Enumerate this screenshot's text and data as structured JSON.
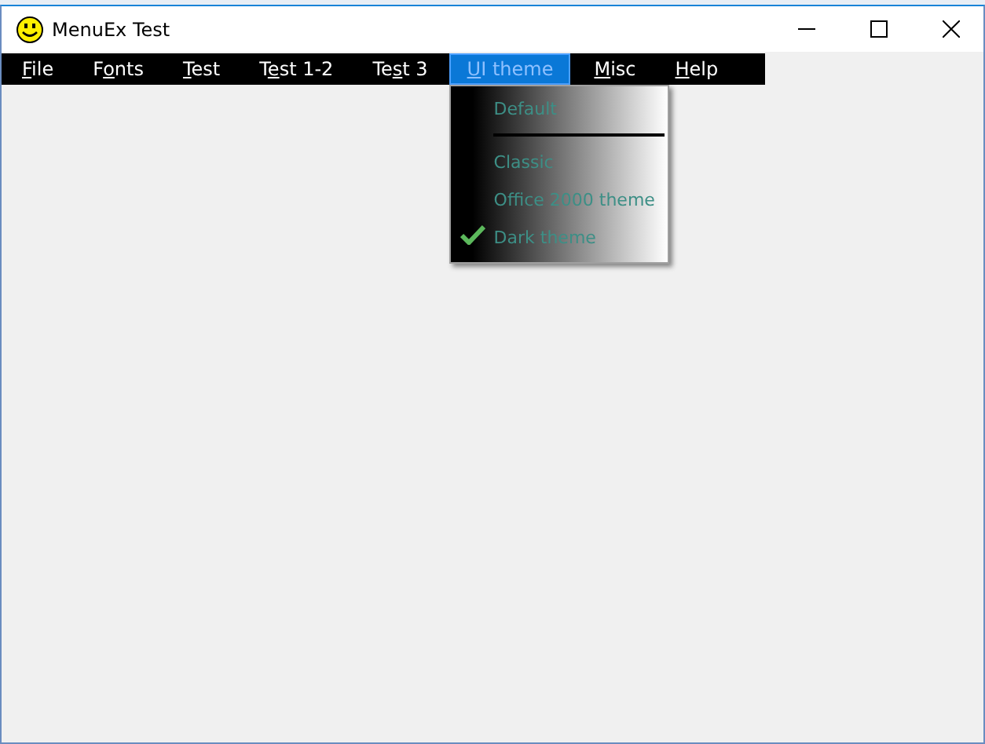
{
  "window": {
    "title": "MenuEx Test"
  },
  "menu_bar": [
    {
      "label": [
        {
          "text": "F",
          "underlined": true
        },
        {
          "text": "ile",
          "underlined": false
        }
      ],
      "selected": false
    },
    {
      "label": [
        {
          "text": "F",
          "underlined": false
        },
        {
          "text": "o",
          "underlined": true
        },
        {
          "text": "nts",
          "underlined": false
        }
      ],
      "selected": false
    },
    {
      "label": [
        {
          "text": "T",
          "underlined": true
        },
        {
          "text": "est",
          "underlined": false
        }
      ],
      "selected": false
    },
    {
      "label": [
        {
          "text": "T",
          "underlined": false
        },
        {
          "text": "e",
          "underlined": true
        },
        {
          "text": "st 1-2",
          "underlined": false
        }
      ],
      "selected": false
    },
    {
      "label": [
        {
          "text": "Te",
          "underlined": false
        },
        {
          "text": "s",
          "underlined": true
        },
        {
          "text": "t 3",
          "underlined": false
        }
      ],
      "selected": false
    },
    {
      "label": [
        {
          "text": "U",
          "underlined": true
        },
        {
          "text": "I theme",
          "underlined": false
        }
      ],
      "selected": true
    },
    {
      "label": [
        {
          "text": "M",
          "underlined": true
        },
        {
          "text": "isc",
          "underlined": false
        }
      ],
      "selected": false
    },
    {
      "label": [
        {
          "text": "H",
          "underlined": true
        },
        {
          "text": "elp",
          "underlined": false
        }
      ],
      "selected": false
    }
  ],
  "dropdown": [
    {
      "kind": "item",
      "label": "Default",
      "checked": false
    },
    {
      "kind": "separator"
    },
    {
      "kind": "item",
      "label": "Classic",
      "checked": false
    },
    {
      "kind": "item",
      "label": "Office 2000 theme",
      "checked": false
    },
    {
      "kind": "item",
      "label": "Dark theme",
      "checked": true
    }
  ]
}
